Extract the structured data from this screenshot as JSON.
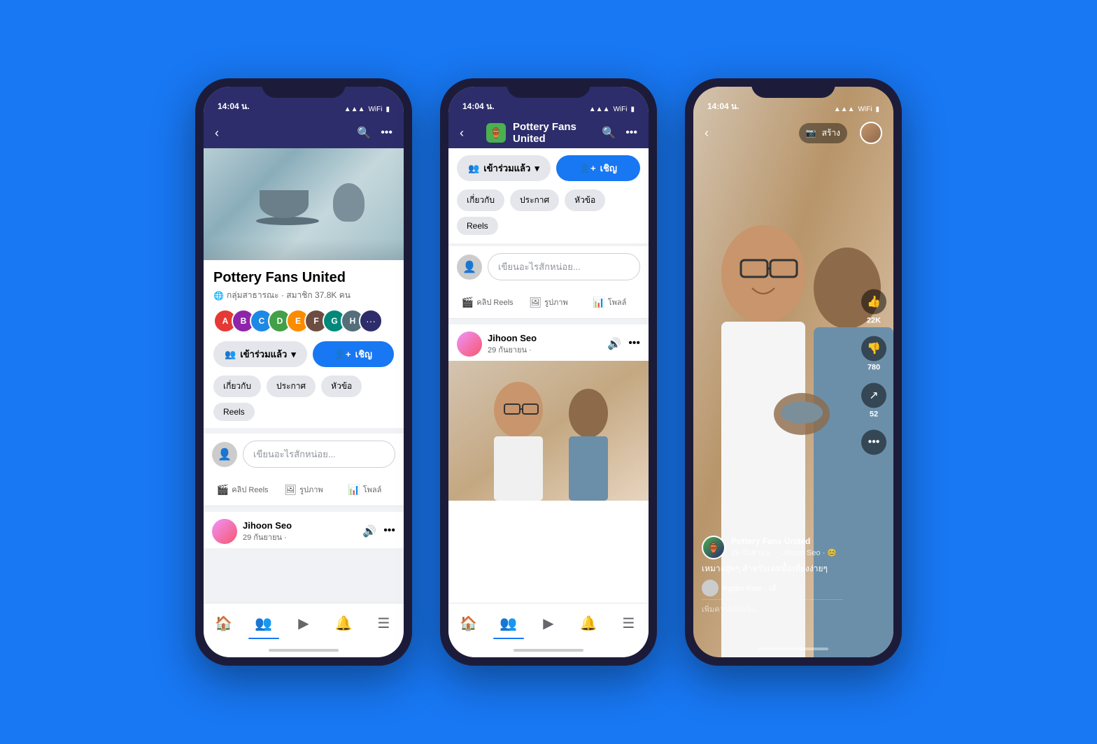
{
  "background": "#1877F2",
  "phone1": {
    "status_time": "14:04 น.",
    "group_name": "Pottery Fans United",
    "group_meta": "กลุ่มสาธารณะ · สมาชิก 37.8K คน",
    "btn_joined": "เข้าร่วมแล้ว",
    "btn_invite": "เชิญ",
    "tabs": [
      "เกี่ยวกับ",
      "ประกาศ",
      "หัวข้อ",
      "Reels"
    ],
    "composer_placeholder": "เขียนอะไรสักหน่อย...",
    "action_reels": "คลิป Reels",
    "action_photo": "รูปภาพ",
    "action_poll": "โพลล์",
    "post_author": "Jihoon Seo",
    "post_date": "29 กันยายน ·"
  },
  "phone2": {
    "status_time": "14:04 น.",
    "group_name": "Pottery Fans United",
    "btn_joined": "เข้าร่วมแล้ว",
    "btn_invite": "เชิญ",
    "tabs": [
      "เกี่ยวกับ",
      "ประกาศ",
      "หัวข้อ",
      "Reels"
    ],
    "composer_placeholder": "เขียนอะไรสักหน่อย...",
    "action_reels": "คลิป Reels",
    "action_photo": "รูปภาพ",
    "action_poll": "โพลล์",
    "post_author": "Jihoon Seo",
    "post_date": "29 กันยายน ·"
  },
  "phone3": {
    "status_time": "14:04 น.",
    "create_label": "สร้าง",
    "group_name": "Pottery Fans United",
    "post_date": "29 กันยายน ·",
    "post_author": "Jihoon Seo",
    "likes_count": "22K",
    "dislikes_count": "780",
    "comments_count": "52",
    "caption": "เหมาะสุดๆ สำหรับเดทมื้อเที่ยงง่ายๆ",
    "commenter_name": "Kyoko Kato · เส้",
    "comment_placeholder": "เพิ่มความคิดเห็น..."
  }
}
